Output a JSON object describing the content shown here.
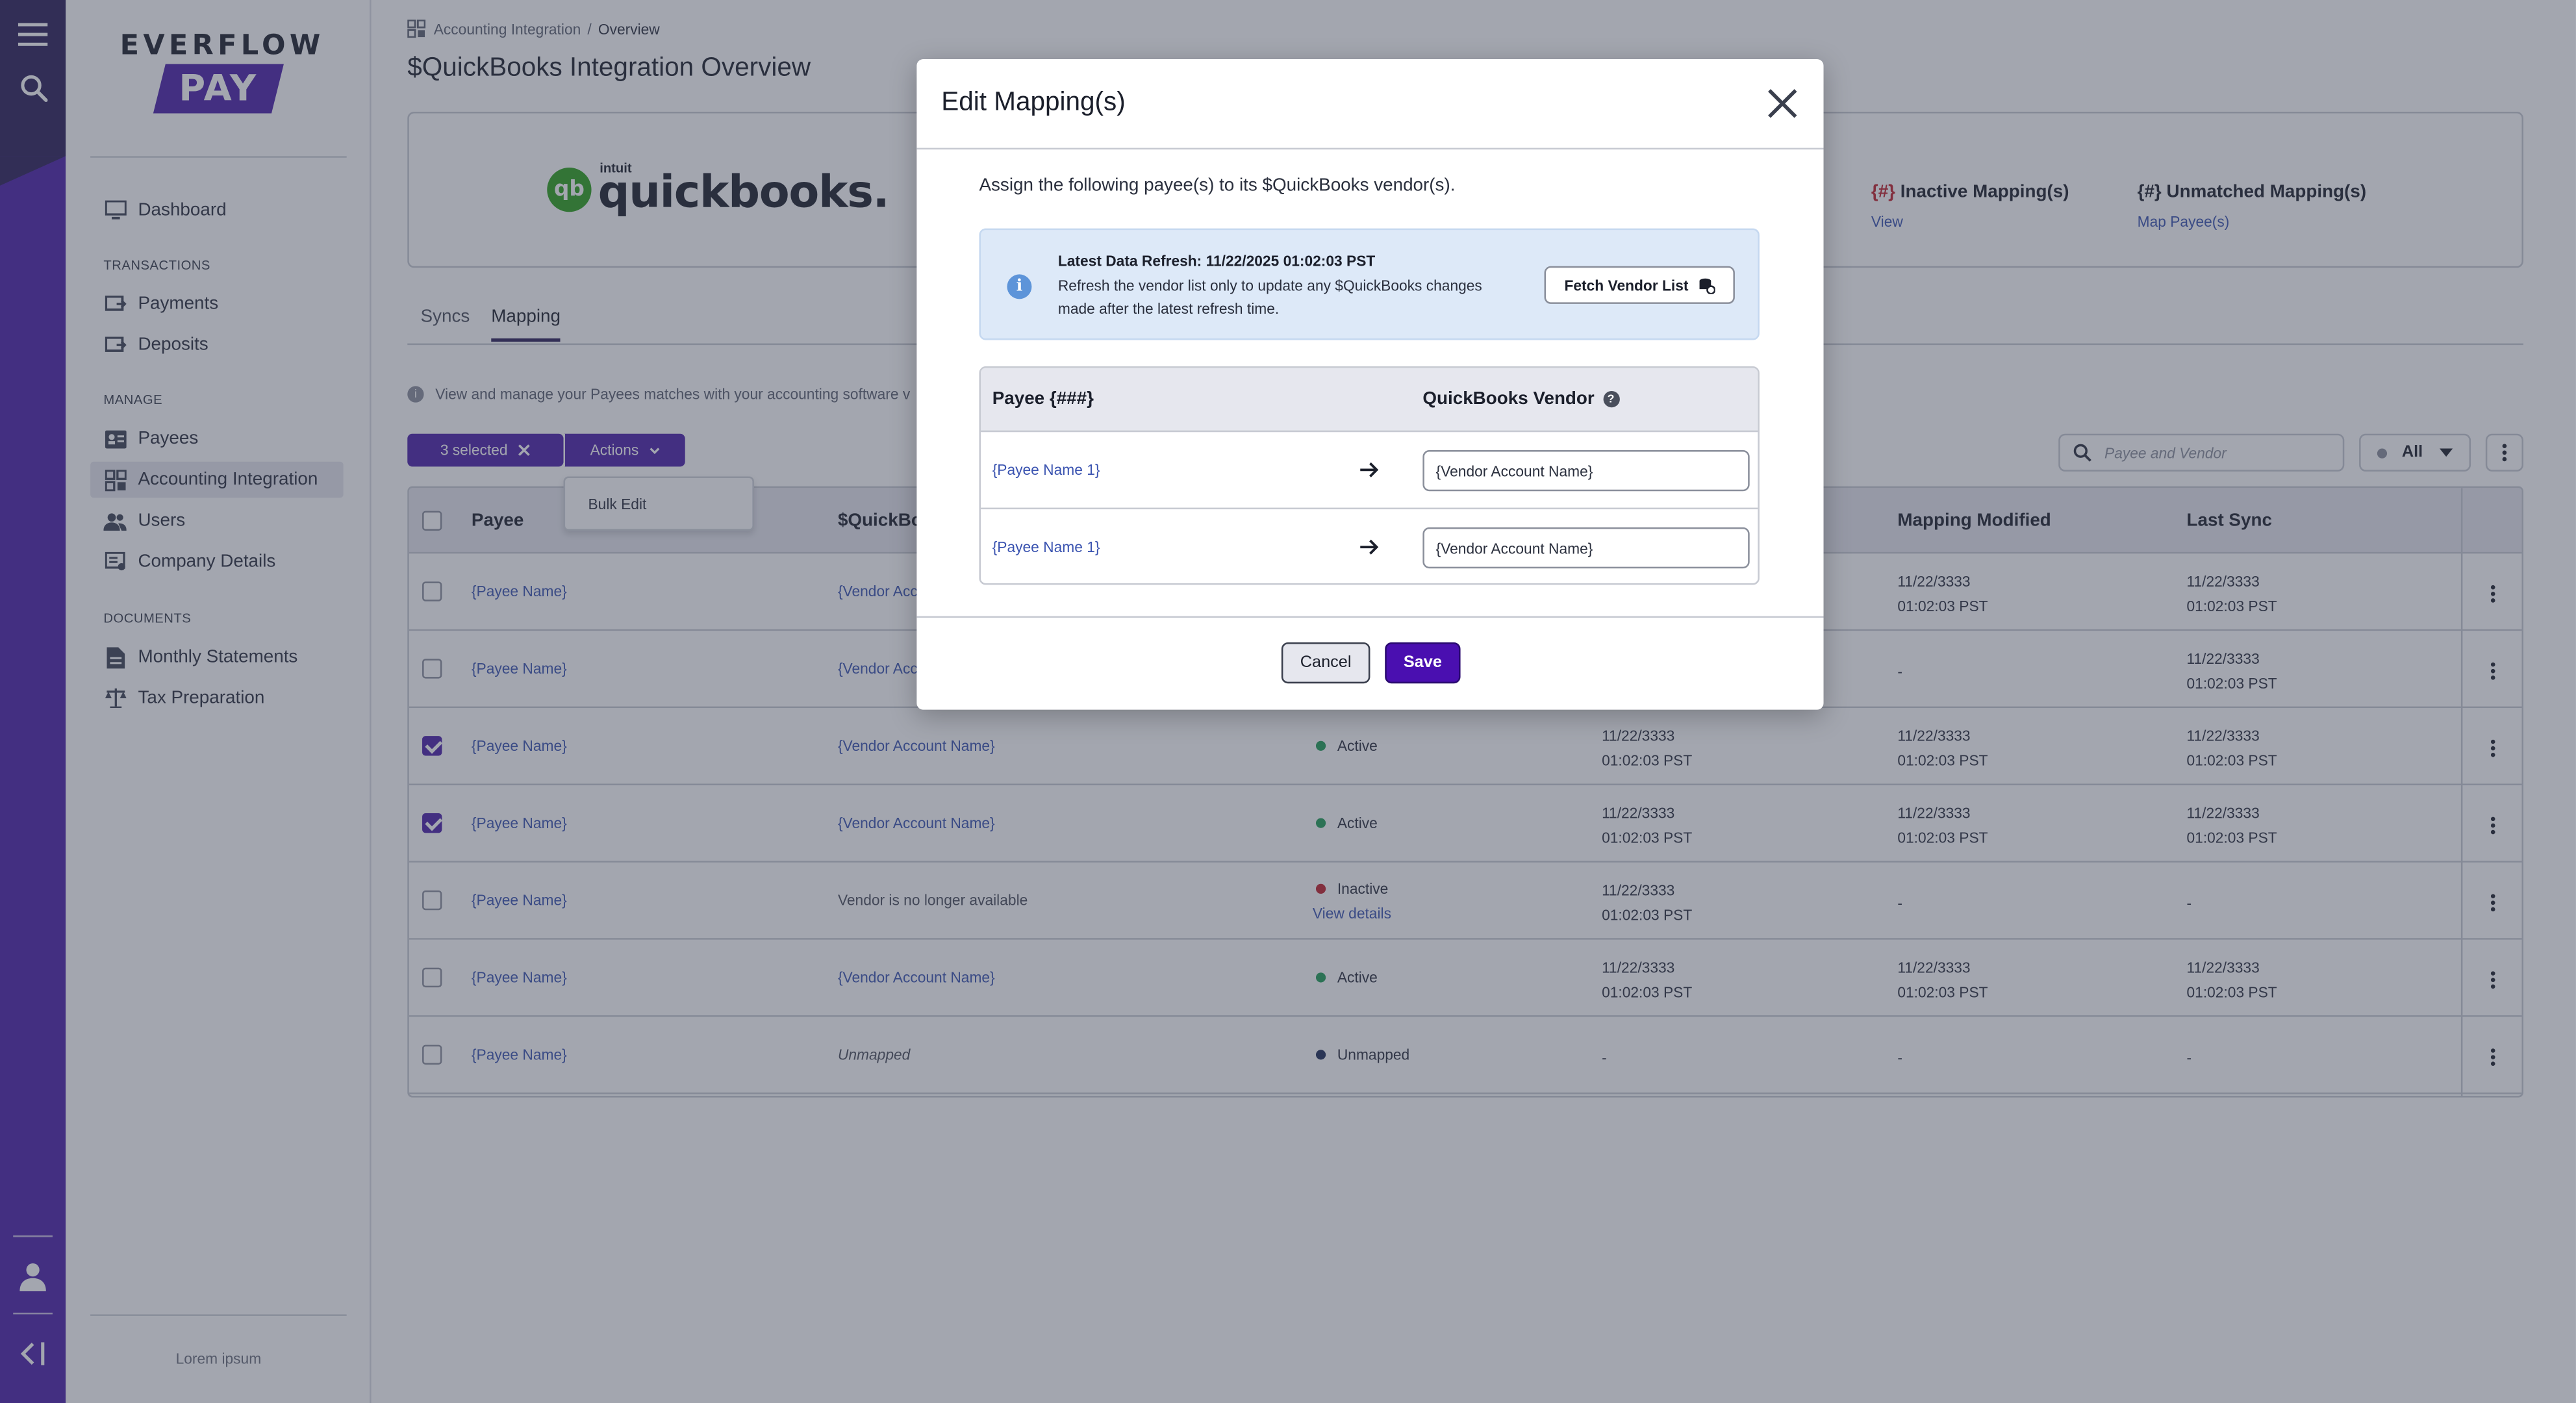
{
  "brand": {
    "word": "EVERFLOW",
    "pay": "PAY",
    "primary": "#4a1fa8",
    "rail_dark": "#2a1d57"
  },
  "rail": {
    "icons": [
      "menu-icon",
      "search-icon",
      "user-icon",
      "collapse-icon"
    ]
  },
  "sidebar": {
    "dashboard": "Dashboard",
    "sections": {
      "transactions": "TRANSACTIONS",
      "manage": "MANAGE",
      "documents": "DOCUMENTS"
    },
    "items": {
      "payments": "Payments",
      "deposits": "Deposits",
      "payees": "Payees",
      "accounting": "Accounting Integration",
      "users": "Users",
      "company": "Company Details",
      "statements": "Monthly Statements",
      "tax": "Tax Preparation"
    },
    "footer": "Lorem ipsum"
  },
  "breadcrumb": {
    "parent": "Accounting Integration",
    "separator": "/",
    "current": "Overview"
  },
  "page_title": "$QuickBooks Integration Overview",
  "summary": {
    "logo_intuit": "intuit",
    "logo_word": "quickbooks.",
    "inactive": {
      "count": "{#}",
      "label": " Inactive Mapping(s)",
      "link": "View"
    },
    "unmatched": {
      "count": "{#}",
      "label": " Unmatched Mapping(s)",
      "link": "Map Payee(s)"
    }
  },
  "tabs": {
    "syncs": "Syncs",
    "mapping": "Mapping"
  },
  "info_text": "View and manage your Payees matches with your accounting software v",
  "toolbar": {
    "selected": "3 selected",
    "actions": "Actions",
    "bulk_edit": "Bulk Edit",
    "search_placeholder": "Payee and Vendor",
    "filter": "All"
  },
  "table": {
    "headers": {
      "payee": "Payee",
      "vendor": "$QuickBo",
      "modified": "Mapping Modified",
      "last_sync": "Last Sync"
    },
    "rows": [
      {
        "checked": false,
        "payee": "{Payee Name}",
        "vendor": "{Vendor Acc",
        "vendor_style": "link",
        "status": "",
        "status_color": "",
        "status_link": "",
        "col4_a": "",
        "col4_b": "",
        "mod_a": "11/22/3333",
        "mod_b": "01:02:03 PST",
        "sync_a": "11/22/3333",
        "sync_b": "01:02:03 PST"
      },
      {
        "checked": false,
        "payee": "{Payee Name}",
        "vendor": "{Vendor Acc",
        "vendor_style": "link",
        "status": "",
        "status_color": "",
        "status_link": "",
        "col4_a": "",
        "col4_b": "",
        "mod_a": "-",
        "mod_b": "",
        "sync_a": "11/22/3333",
        "sync_b": "01:02:03 PST"
      },
      {
        "checked": true,
        "payee": "{Payee Name}",
        "vendor": "{Vendor Account Name}",
        "vendor_style": "link",
        "status": "Active",
        "status_color": "#1f9d55",
        "status_link": "",
        "col4_a": "11/22/3333",
        "col4_b": "01:02:03 PST",
        "mod_a": "11/22/3333",
        "mod_b": "01:02:03 PST",
        "sync_a": "11/22/3333",
        "sync_b": "01:02:03 PST"
      },
      {
        "checked": true,
        "payee": "{Payee Name}",
        "vendor": "{Vendor Account Name}",
        "vendor_style": "link",
        "status": "Active",
        "status_color": "#1f9d55",
        "status_link": "",
        "col4_a": "11/22/3333",
        "col4_b": "01:02:03 PST",
        "mod_a": "11/22/3333",
        "mod_b": "01:02:03 PST",
        "sync_a": "11/22/3333",
        "sync_b": "01:02:03 PST"
      },
      {
        "checked": false,
        "payee": "{Payee Name}",
        "vendor": "Vendor is no longer available",
        "vendor_style": "muted",
        "status": "Inactive",
        "status_color": "#c01f2b",
        "status_link": "View details",
        "col4_a": "11/22/3333",
        "col4_b": "01:02:03 PST",
        "mod_a": "-",
        "mod_b": "",
        "sync_a": "-",
        "sync_b": ""
      },
      {
        "checked": false,
        "payee": "{Payee Name}",
        "vendor": "{Vendor Account Name}",
        "vendor_style": "link",
        "status": "Active",
        "status_color": "#1f9d55",
        "status_link": "",
        "col4_a": "11/22/3333",
        "col4_b": "01:02:03 PST",
        "mod_a": "11/22/3333",
        "mod_b": "01:02:03 PST",
        "sync_a": "11/22/3333",
        "sync_b": "01:02:03 PST"
      },
      {
        "checked": false,
        "payee": "{Payee Name}",
        "vendor": "Unmapped",
        "vendor_style": "ital",
        "status": "Unmapped",
        "status_color": "#1b2a55",
        "status_link": "",
        "col4_a": "-",
        "col4_b": "",
        "mod_a": "-",
        "mod_b": "",
        "sync_a": "-",
        "sync_b": ""
      }
    ]
  },
  "modal": {
    "title": "Edit Mapping(s)",
    "description": "Assign the following payee(s) to its $QuickBooks vendor(s).",
    "banner_title": "Latest Data Refresh: 11/22/2025 01:02:03 PST",
    "banner_text": "Refresh the vendor list only to update any $QuickBooks changes made after the latest refresh time.",
    "fetch_button": "Fetch Vendor List",
    "col_payee": "Payee {###}",
    "col_vendor": "QuickBooks Vendor",
    "rows": [
      {
        "payee": "{Payee Name 1}",
        "vendor_value": "{Vendor Account Name}"
      },
      {
        "payee": "{Payee Name 1}",
        "vendor_value": "{Vendor Account Name}"
      }
    ],
    "cancel": "Cancel",
    "save": "Save"
  }
}
